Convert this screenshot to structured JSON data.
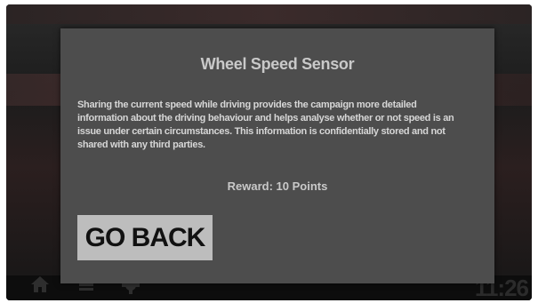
{
  "modal": {
    "title": "Wheel Speed Sensor",
    "description": "Sharing the current speed while driving provides the campaign more detailed information about the driving behaviour and helps analyse whether or not speed is an issue under certain circumstances. This information is confidentially stored and not shared with any third parties.",
    "reward": "Reward: 10 Points",
    "back_label": "GO BACK"
  },
  "status_bar": {
    "time": "11:26",
    "icons": [
      "home-icon",
      "list-icon",
      "settings-icon"
    ]
  }
}
